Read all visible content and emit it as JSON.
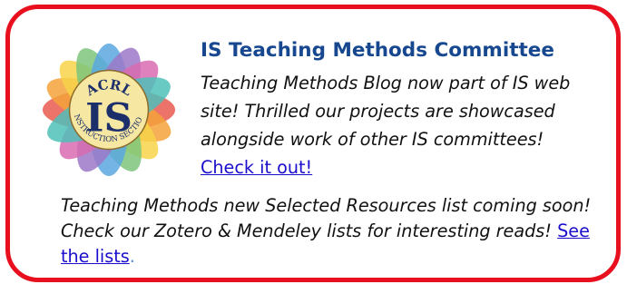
{
  "logo": {
    "top_text": "ACRL",
    "center_text": "IS",
    "bottom_text": "INSTRUCTION SECTION",
    "petal_colors": [
      "#e85a50",
      "#f4a23a",
      "#f7d44a",
      "#7cc47a",
      "#5aa7e0",
      "#9c78c8",
      "#d86bb0",
      "#4fc0b8"
    ]
  },
  "title": "IS Teaching Methods Committee",
  "para1": {
    "text": "Teaching Methods Blog now part of IS web site! Thrilled our projects are showcased alongside work of other IS committees!",
    "link_label": "Check it out!"
  },
  "para2": {
    "text": "Teaching Methods new Selected Resources list coming soon! Check our Zotero & Mendeley lists for interesting reads!",
    "link_label": "See the lists",
    "suffix": "."
  },
  "colors": {
    "border": "#e8101e",
    "title": "#17488f",
    "link": "#1a0dcc"
  }
}
